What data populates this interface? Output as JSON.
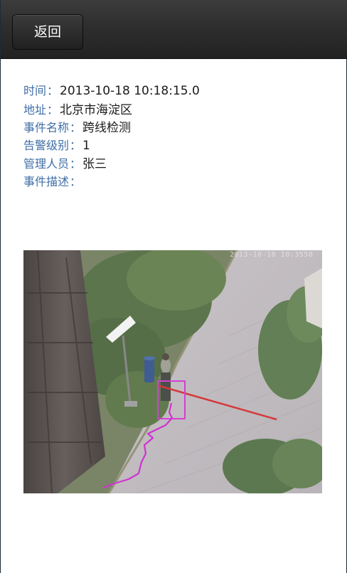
{
  "header": {
    "back_label": "返回"
  },
  "event": {
    "fields": [
      {
        "label": "时间",
        "value": "2013-10-18 10:18:15.0"
      },
      {
        "label": "地址",
        "value": "北京市海淀区"
      },
      {
        "label": "事件名称",
        "value": "跨线检测"
      },
      {
        "label": "告警级别",
        "value": "1"
      },
      {
        "label": "管理人员",
        "value": "张三"
      },
      {
        "label": "事件描述",
        "value": ""
      }
    ],
    "separator": "："
  },
  "snapshot": {
    "timestamp_overlay": "2013-10-18 10:3550",
    "colors": {
      "detection_box": "#d12fd1",
      "trajectory": "#cc22cc",
      "cross_line": "#d3262a"
    }
  }
}
